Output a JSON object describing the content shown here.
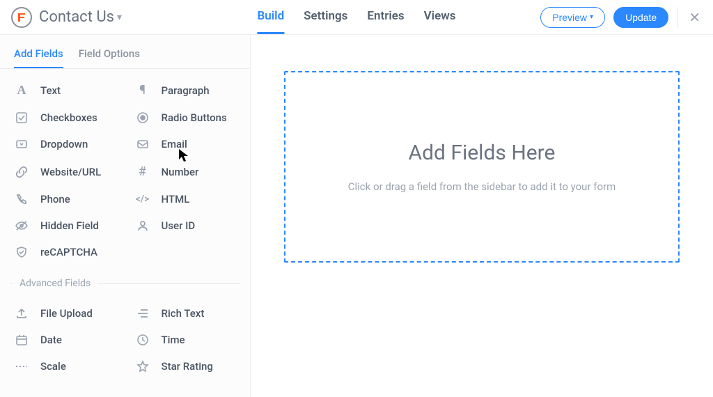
{
  "header": {
    "form_title": "Contact Us",
    "nav": {
      "build": "Build",
      "settings": "Settings",
      "entries": "Entries",
      "views": "Views"
    },
    "preview_label": "Preview",
    "update_label": "Update"
  },
  "sidebar": {
    "tabs": {
      "add_fields": "Add Fields",
      "field_options": "Field Options"
    },
    "basic_fields": [
      {
        "icon": "text",
        "label": "Text"
      },
      {
        "icon": "paragraph",
        "label": "Paragraph"
      },
      {
        "icon": "checkbox",
        "label": "Checkboxes"
      },
      {
        "icon": "radio",
        "label": "Radio Buttons"
      },
      {
        "icon": "dropdown",
        "label": "Dropdown"
      },
      {
        "icon": "email",
        "label": "Email"
      },
      {
        "icon": "link",
        "label": "Website/URL"
      },
      {
        "icon": "hash",
        "label": "Number"
      },
      {
        "icon": "phone",
        "label": "Phone"
      },
      {
        "icon": "code",
        "label": "HTML"
      },
      {
        "icon": "hidden",
        "label": "Hidden Field"
      },
      {
        "icon": "user",
        "label": "User ID"
      },
      {
        "icon": "shield",
        "label": "reCAPTCHA"
      }
    ],
    "advanced_section_label": "Advanced Fields",
    "advanced_fields": [
      {
        "icon": "upload",
        "label": "File Upload"
      },
      {
        "icon": "richtext",
        "label": "Rich Text"
      },
      {
        "icon": "date",
        "label": "Date"
      },
      {
        "icon": "time",
        "label": "Time"
      },
      {
        "icon": "scale",
        "label": "Scale"
      },
      {
        "icon": "star",
        "label": "Star Rating"
      }
    ]
  },
  "canvas": {
    "dropzone_title": "Add Fields Here",
    "dropzone_subtitle": "Click or drag a field from the sidebar to add it to your form"
  }
}
